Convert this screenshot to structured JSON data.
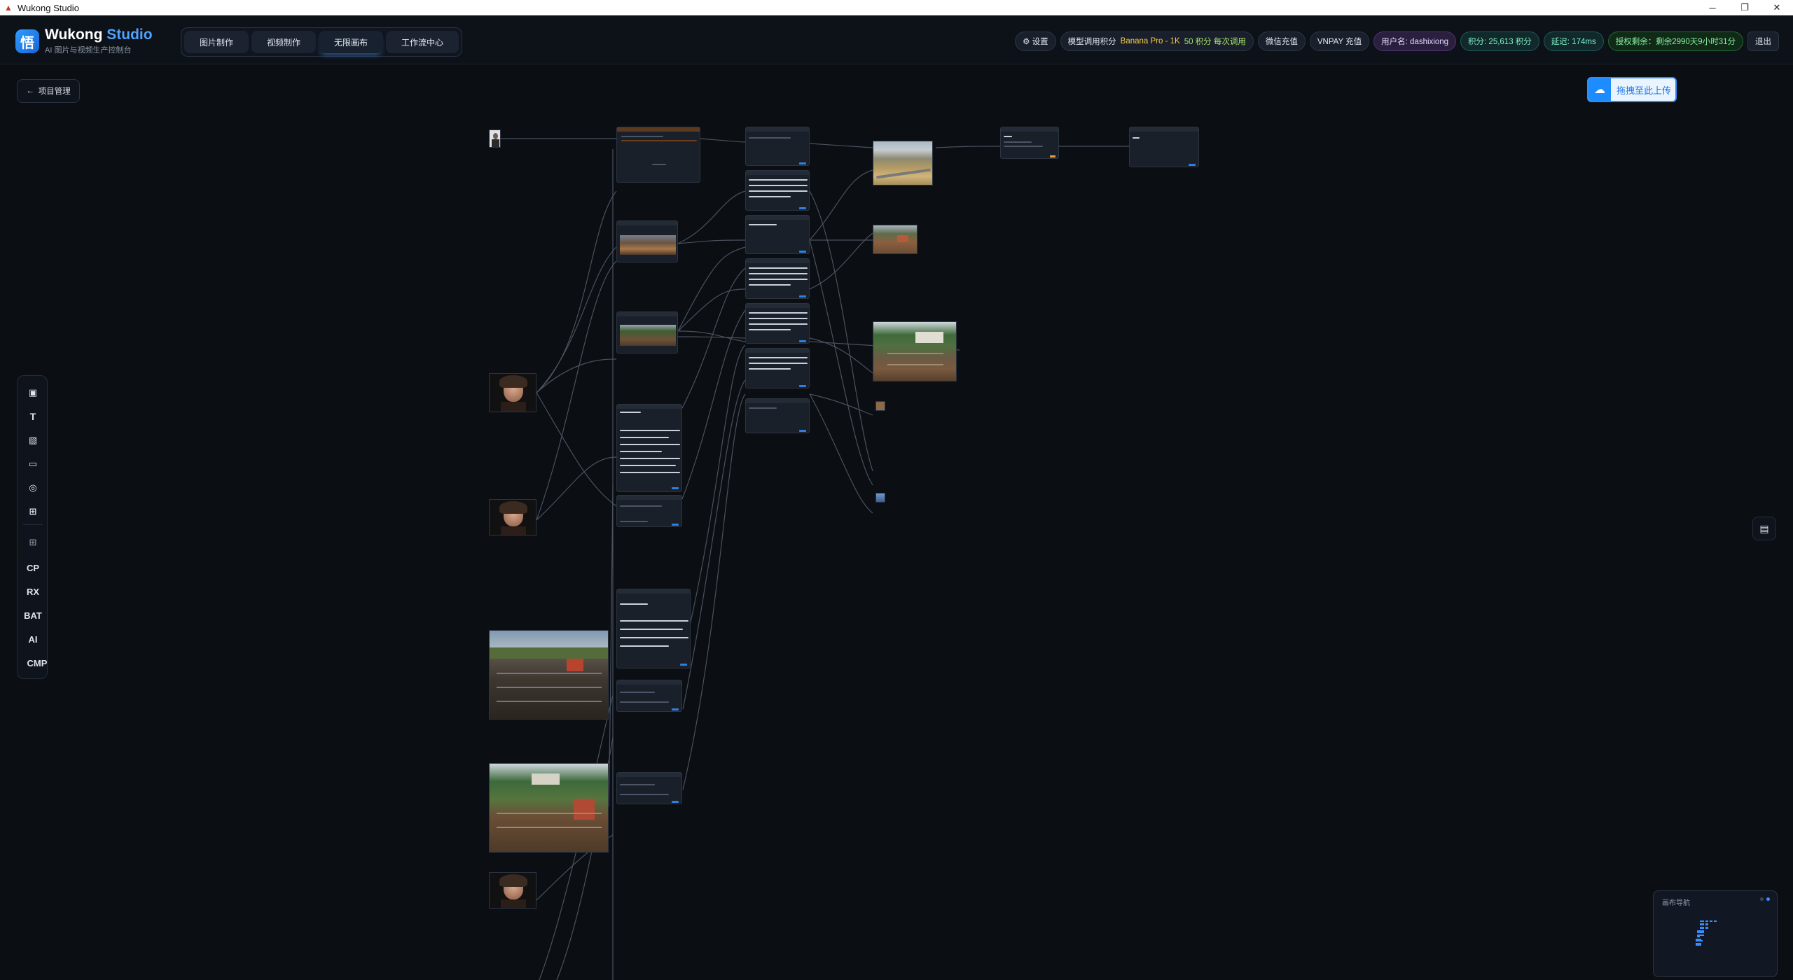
{
  "window": {
    "title": "Wukong Studio",
    "minimize": "─",
    "restore": "❐",
    "close": "✕"
  },
  "brand": {
    "logo_char": "悟",
    "title_main": "Wukong",
    "title_accent": "Studio",
    "subtitle": "AI 图片与视频生产控制台"
  },
  "tabs": [
    {
      "label": "图片制作",
      "active": false
    },
    {
      "label": "视频制作",
      "active": false
    },
    {
      "label": "无限画布",
      "active": true
    },
    {
      "label": "工作流中心",
      "active": false
    }
  ],
  "header_right": {
    "settings": "⚙ 设置",
    "model_cost_prefix": "模型调用积分",
    "model_name": "Banana Pro - 1K",
    "model_cost": "50 积分 每次调用",
    "wechat_topup": "微信充值",
    "vnpay_topup": "VNPAY 充值",
    "username": "用户名: dashixiong",
    "points": "积分: 25,613 积分",
    "latency": "延迟: 174ms",
    "license": "授权剩余：剩余2990天9小时31分",
    "logout": "退出"
  },
  "back_button": {
    "icon": "←",
    "label": "项目管理"
  },
  "upload_button": {
    "label": "拖拽至此上传",
    "icon": "cloud-upload-icon"
  },
  "toolbar": {
    "items": [
      {
        "name": "image-gen-tool",
        "icon": "▣",
        "type": "icon"
      },
      {
        "name": "text-tool",
        "label": "T",
        "type": "text"
      },
      {
        "name": "image-edit-tool",
        "icon": "▧",
        "type": "icon"
      },
      {
        "name": "video-tool",
        "icon": "▭",
        "type": "icon"
      },
      {
        "name": "style-tool",
        "icon": "◎",
        "type": "icon"
      },
      {
        "name": "grid-tool",
        "icon": "⊞",
        "type": "icon"
      },
      {
        "name": "grid-alt-tool",
        "icon": "⊞",
        "type": "icon"
      },
      {
        "name": "cp-tool",
        "label": "CP",
        "type": "text"
      },
      {
        "name": "rx-tool",
        "label": "RX",
        "type": "text"
      },
      {
        "name": "bat-tool",
        "label": "BAT",
        "type": "text"
      },
      {
        "name": "ai-tool",
        "label": "AI",
        "type": "text"
      },
      {
        "name": "cmp-tool",
        "label": "CMP",
        "type": "text"
      }
    ]
  },
  "chat_button": {
    "icon": "chat-icon"
  },
  "minimap": {
    "title": "画布导航"
  }
}
